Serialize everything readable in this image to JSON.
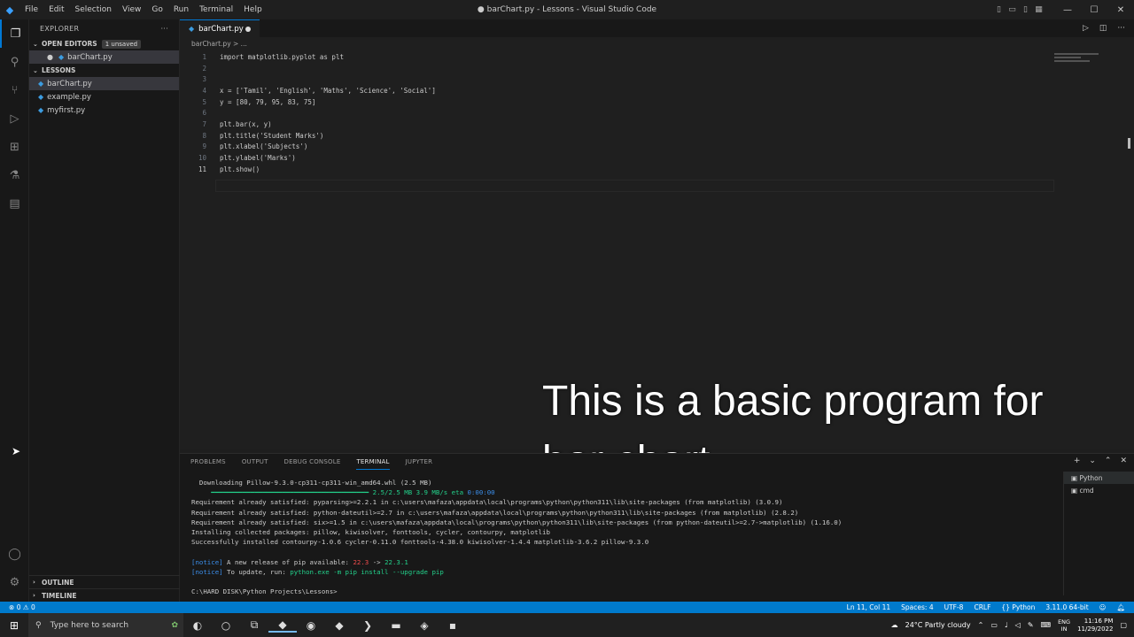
{
  "window": {
    "title": "● barChart.py - Lessons - Visual Studio Code",
    "menu": [
      "File",
      "Edit",
      "Selection",
      "View",
      "Go",
      "Run",
      "Terminal",
      "Help"
    ]
  },
  "explorer": {
    "header": "EXPLORER",
    "open_editors_label": "OPEN EDITORS",
    "unsaved_badge": "1 unsaved",
    "open_files": [
      "barChart.py"
    ],
    "folder_label": "LESSONS",
    "files": [
      "barChart.py",
      "example.py",
      "myfirst.py"
    ],
    "outline_label": "OUTLINE",
    "timeline_label": "TIMELINE"
  },
  "editor": {
    "tab_label": "barChart.py",
    "breadcrumb": "barChart.py > ...",
    "lines": [
      "import matplotlib.pyplot as plt",
      "",
      "",
      "x = ['Tamil', 'English', 'Maths', 'Science', 'Social']",
      "y = [80, 79, 95, 83, 75]",
      "",
      "plt.bar(x, y)",
      "plt.title('Student Marks')",
      "plt.xlabel('Subjects')",
      "plt.ylabel('Marks')",
      "plt.show()"
    ],
    "line_numbers": [
      "1",
      "2",
      "3",
      "4",
      "5",
      "6",
      "7",
      "8",
      "9",
      "10",
      "11"
    ]
  },
  "caption": {
    "line1": "This is a basic program for",
    "line2": "bar chart."
  },
  "panel": {
    "tabs": [
      "PROBLEMS",
      "OUTPUT",
      "DEBUG CONSOLE",
      "TERMINAL",
      "JUPYTER"
    ],
    "terminal_lines": {
      "l1": "  Downloading Pillow-9.3.0-cp311-cp311-win_amd64.whl (2.5 MB)",
      "l2a": "     ━━━━━━━━━━━━━━━━━━━━━━━━━━━━━━━━━━━━━━━━ 2.5/2.5 MB 3.9 MB/s eta ",
      "l2b": "0:00:00",
      "l3": "Requirement already satisfied: pyparsing>=2.2.1 in c:\\users\\mafaza\\appdata\\local\\programs\\python\\python311\\lib\\site-packages (from matplotlib) (3.0.9)",
      "l4": "Requirement already satisfied: python-dateutil>=2.7 in c:\\users\\mafaza\\appdata\\local\\programs\\python\\python311\\lib\\site-packages (from matplotlib) (2.8.2)",
      "l5": "Requirement already satisfied: six>=1.5 in c:\\users\\mafaza\\appdata\\local\\programs\\python\\python311\\lib\\site-packages (from python-dateutil>=2.7->matplotlib) (1.16.0)",
      "l6": "Installing collected packages: pillow, kiwisolver, fonttools, cycler, contourpy, matplotlib",
      "l7": "Successfully installed contourpy-1.0.6 cycler-0.11.0 fonttools-4.38.0 kiwisolver-1.4.4 matplotlib-3.6.2 pillow-9.3.0",
      "l8a": "[notice]",
      "l8b": " A new release of pip available: ",
      "l8c": "22.3",
      "l8d": " -> ",
      "l8e": "22.3.1",
      "l9a": "[notice]",
      "l9b": " To update, run: ",
      "l9c": "python.exe -m pip install --upgrade pip",
      "l10": "C:\\HARD DISK\\Python Projects\\Lessons>"
    },
    "terminal_instances": [
      "Python",
      "cmd"
    ]
  },
  "status": {
    "errors": "0",
    "warnings": "0",
    "position": "Ln 11, Col 11",
    "spaces": "Spaces: 4",
    "encoding": "UTF-8",
    "eol": "CRLF",
    "language": "Python",
    "interpreter": "3.11.0 64-bit"
  },
  "taskbar": {
    "search_placeholder": "Type here to search",
    "weather": "24°C  Partly cloudy",
    "lang_top": "ENG",
    "lang_bottom": "IN",
    "time": "11:16 PM",
    "date": "11/29/2022"
  }
}
